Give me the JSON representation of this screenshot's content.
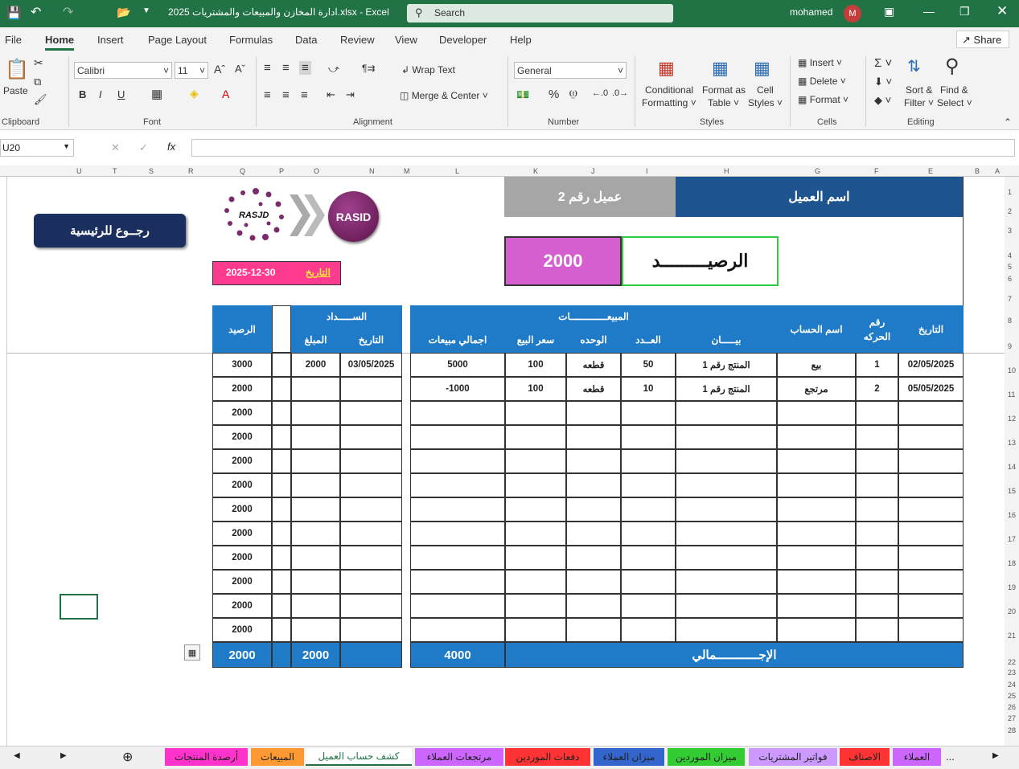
{
  "window": {
    "title": "ادارة المخازن والمبيعات والمشتريات 2025.xlsx  -  Excel",
    "search_placeholder": "Search",
    "user": "mohamed",
    "avatar_letter": "M"
  },
  "menu": [
    "File",
    "Home",
    "Insert",
    "Page Layout",
    "Formulas",
    "Data",
    "Review",
    "View",
    "Developer",
    "Help"
  ],
  "share": "Share",
  "ribbon": {
    "paste": "Paste",
    "clipboard": "Clipboard",
    "font_name": "Calibri",
    "font_size": "11",
    "font": "Font",
    "wrap": "Wrap Text",
    "merge": "Merge & Center",
    "alignment": "Alignment",
    "number_format": "General",
    "number": "Number",
    "cond1": "Conditional",
    "cond2": "Formatting",
    "fmt1": "Format as",
    "fmt2": "Table",
    "cell1": "Cell",
    "cell2": "Styles",
    "styles": "Styles",
    "insert": "Insert",
    "delete": "Delete",
    "format": "Format",
    "cells": "Cells",
    "sort1": "Sort &",
    "sort2": "Filter",
    "find1": "Find &",
    "find2": "Select",
    "editing": "Editing"
  },
  "namebox": "U20",
  "columns": [
    "U",
    "T",
    "S",
    "R",
    "Q",
    "P",
    "O",
    "N",
    "M",
    "L",
    "K",
    "J",
    "I",
    "H",
    "G",
    "F",
    "E",
    "B",
    "A"
  ],
  "rows": [
    "1",
    "2",
    "3",
    "4",
    "5",
    "6",
    "7",
    "8",
    "9",
    "10",
    "11",
    "12",
    "13",
    "14",
    "15",
    "16",
    "17",
    "18",
    "19",
    "20",
    "21",
    "22",
    "23",
    "24",
    "25",
    "26",
    "27",
    "28"
  ],
  "header": {
    "customer_label": "اسم العميل",
    "customer_name": "عميل رقم 2",
    "balance_label": "الرصيـــــــــد",
    "balance_value": "2000",
    "date_label": "التاريخ",
    "date_value": "2025-12-30",
    "back_button": "رجــوع للرئيسية",
    "logo_text": "RASJD",
    "logo_badge": "RASID"
  },
  "table": {
    "h_date": "التاريخ",
    "h_move": "رقم الحركه",
    "h_account": "اسم الحساب",
    "h_sales": "المبيعـــــــــــــات",
    "h_desc": "بيـــــان",
    "h_qty": "العــدد",
    "h_unit": "الوحده",
    "h_price": "سعر البيع",
    "h_total": "اجمالي مبيعات",
    "h_payment": "الســـــداد",
    "h_pdate": "التاريخ",
    "h_pamount": "المبلغ",
    "h_balance": "الرصيد",
    "rows": [
      {
        "date": "02/05/2025",
        "move": "1",
        "account": "بيع",
        "desc": "المنتج رقم 1",
        "qty": "50",
        "unit": "قطعه",
        "price": "100",
        "total": "5000",
        "pdate": "03/05/2025",
        "pamount": "2000",
        "balance": "3000"
      },
      {
        "date": "05/05/2025",
        "move": "2",
        "account": "مرتجع",
        "desc": "المنتج رقم 1",
        "qty": "10",
        "unit": "قطعه",
        "price": "100",
        "total": "-1000",
        "pdate": "",
        "pamount": "",
        "balance": "2000"
      },
      {
        "date": "",
        "move": "",
        "account": "",
        "desc": "",
        "qty": "",
        "unit": "",
        "price": "",
        "total": "",
        "pdate": "",
        "pamount": "",
        "balance": "2000"
      },
      {
        "date": "",
        "move": "",
        "account": "",
        "desc": "",
        "qty": "",
        "unit": "",
        "price": "",
        "total": "",
        "pdate": "",
        "pamount": "",
        "balance": "2000"
      },
      {
        "date": "",
        "move": "",
        "account": "",
        "desc": "",
        "qty": "",
        "unit": "",
        "price": "",
        "total": "",
        "pdate": "",
        "pamount": "",
        "balance": "2000"
      },
      {
        "date": "",
        "move": "",
        "account": "",
        "desc": "",
        "qty": "",
        "unit": "",
        "price": "",
        "total": "",
        "pdate": "",
        "pamount": "",
        "balance": "2000"
      },
      {
        "date": "",
        "move": "",
        "account": "",
        "desc": "",
        "qty": "",
        "unit": "",
        "price": "",
        "total": "",
        "pdate": "",
        "pamount": "",
        "balance": "2000"
      },
      {
        "date": "",
        "move": "",
        "account": "",
        "desc": "",
        "qty": "",
        "unit": "",
        "price": "",
        "total": "",
        "pdate": "",
        "pamount": "",
        "balance": "2000"
      },
      {
        "date": "",
        "move": "",
        "account": "",
        "desc": "",
        "qty": "",
        "unit": "",
        "price": "",
        "total": "",
        "pdate": "",
        "pamount": "",
        "balance": "2000"
      },
      {
        "date": "",
        "move": "",
        "account": "",
        "desc": "",
        "qty": "",
        "unit": "",
        "price": "",
        "total": "",
        "pdate": "",
        "pamount": "",
        "balance": "2000"
      },
      {
        "date": "",
        "move": "",
        "account": "",
        "desc": "",
        "qty": "",
        "unit": "",
        "price": "",
        "total": "",
        "pdate": "",
        "pamount": "",
        "balance": "2000"
      },
      {
        "date": "",
        "move": "",
        "account": "",
        "desc": "",
        "qty": "",
        "unit": "",
        "price": "",
        "total": "",
        "pdate": "",
        "pamount": "",
        "balance": "2000"
      }
    ],
    "total_label": "الإجــــــــــــمالي",
    "total_sales": "4000",
    "total_paid": "2000",
    "total_balance": "2000"
  },
  "sheet_tabs": [
    {
      "label": "أرصدة المنتجات",
      "color": "#ff33cc"
    },
    {
      "label": "المبيعات",
      "color": "#ff9933"
    },
    {
      "label": "كشف حساب العميل",
      "color": "#ffffff"
    },
    {
      "label": "مرتجعات العملاء",
      "color": "#cc66ff"
    },
    {
      "label": "دفعات الموردين",
      "color": "#ff3333"
    },
    {
      "label": "ميزان العملاء",
      "color": "#3366cc"
    },
    {
      "label": "ميزان الموردين",
      "color": "#33cc33"
    },
    {
      "label": "فواتير المشتريات",
      "color": "#cc99ff"
    },
    {
      "label": "الاصناف",
      "color": "#ff3333"
    },
    {
      "label": "العملاء",
      "color": "#cc66ff"
    }
  ],
  "more_tabs": "..."
}
